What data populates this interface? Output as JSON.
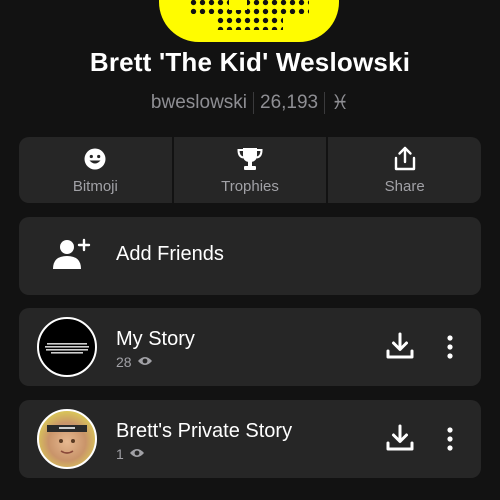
{
  "profile": {
    "display_name": "Brett 'The Kid' Weslowski",
    "username": "bweslowski",
    "score": "26,193",
    "zodiac_symbol": "♓"
  },
  "actions": [
    {
      "label": "Bitmoji",
      "icon": "bitmoji-icon"
    },
    {
      "label": "Trophies",
      "icon": "trophy-icon"
    },
    {
      "label": "Share",
      "icon": "share-icon"
    }
  ],
  "add_friends": {
    "label": "Add Friends",
    "icon": "add-friend-icon"
  },
  "stories": [
    {
      "title": "My Story",
      "views": "28",
      "icon": "eye-icon"
    },
    {
      "title": "Brett's Private Story",
      "views": "1",
      "icon": "eye-icon"
    }
  ],
  "colors": {
    "background": "#121212",
    "card": "#262626",
    "snapcode": "#FFFC00",
    "muted_text": "#8e8e93"
  }
}
